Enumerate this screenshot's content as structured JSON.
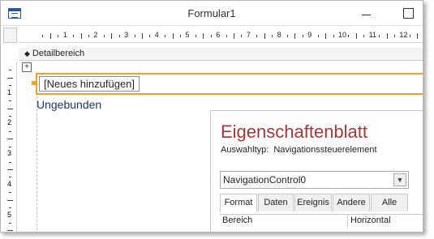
{
  "window": {
    "title": "Formular1"
  },
  "ruler": {
    "horizontal_numbers": [
      "1",
      "2",
      "3",
      "4",
      "5",
      "6",
      "7",
      "8",
      "9",
      "10",
      "11",
      "12",
      "13"
    ],
    "vertical_numbers": [
      "1",
      "2",
      "3",
      "4",
      "5"
    ]
  },
  "section": {
    "label": "Detailbereich"
  },
  "form": {
    "nav_button_label": "[Neues hinzufügen]",
    "unbound_label": "Ungebunden"
  },
  "property_sheet": {
    "title": "Eigenschaftenblatt",
    "selection_type_label": "Auswahltyp:",
    "selection_type_value": "Navigationssteuerelement",
    "selected_control": "NavigationControl0",
    "tabs": [
      "Format",
      "Daten",
      "Ereignis",
      "Andere",
      "Alle"
    ],
    "active_tab": "Format",
    "rows": [
      {
        "name": "Bereich",
        "value": "Horizontal"
      }
    ]
  },
  "colors": {
    "accent_orange": "#f0a030",
    "property_title": "#a4373a",
    "unbound_text": "#1f3864"
  }
}
